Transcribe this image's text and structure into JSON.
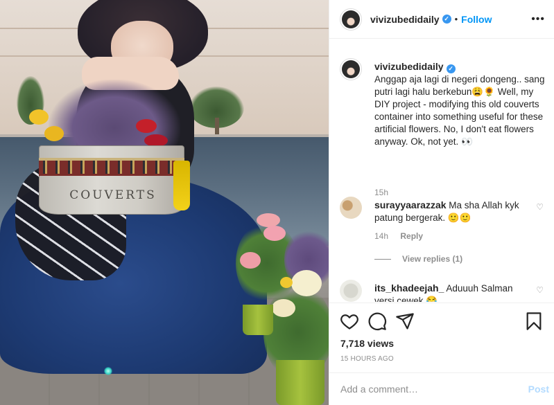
{
  "header": {
    "username": "vivizubedidaily",
    "separator": "•",
    "follow_label": "Follow",
    "more_label": "•••"
  },
  "caption": {
    "username": "vivizubedidaily",
    "text": "Anggap aja lagi di negeri dongeng.. sang putri lagi halu berkebun😩🌻 Well, my DIY project - modifying this old couverts container into something useful for these artificial flowers. No, I don't eat flowers anyway. Ok, not yet. 👀",
    "time": "15h"
  },
  "photo": {
    "container_label": "COUVERTS"
  },
  "comments": [
    {
      "username": "surayyaarazzak",
      "text": "Ma sha Allah kyk patung bergerak. 🙂🙂",
      "time": "14h",
      "reply_label": "Reply"
    },
    {
      "username": "its_khadeejah_",
      "text": "Aduuuh Salman versi cewek 😂"
    }
  ],
  "view_replies": "View replies (1)",
  "stats": {
    "views": "7,718 views",
    "timestamp": "15 HOURS AGO"
  },
  "add_comment": {
    "placeholder": "Add a comment…",
    "post_label": "Post"
  },
  "icons": {
    "like": "heart-icon",
    "comment": "comment-icon",
    "share": "share-icon",
    "save": "bookmark-icon",
    "verified": "verified-badge-icon"
  },
  "colors": {
    "accent": "#0095f6",
    "verified": "#3897f0",
    "post_disabled": "#b3dbff",
    "muted": "#8e8e8e"
  }
}
